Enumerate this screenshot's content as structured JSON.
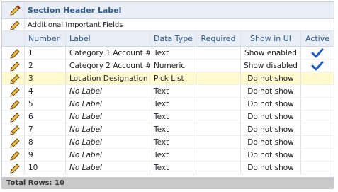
{
  "section_title": "Section Header Label",
  "subtitle": "Additional Important Fields",
  "columns": {
    "number": "Number",
    "label": "Label",
    "data_type": "Data Type",
    "required": "Required",
    "show_in_ui": "Show in UI",
    "active": "Active"
  },
  "rows": [
    {
      "number": "1",
      "label": "Category 1 Account #",
      "data_type": "Text",
      "required": "",
      "show_in_ui": "Show enabled",
      "active": true
    },
    {
      "number": "2",
      "label": "Category 2 Account #",
      "data_type": "Numeric",
      "required": "",
      "show_in_ui": "Show disabled",
      "active": true
    },
    {
      "number": "3",
      "label": "Location Designation",
      "data_type": "Pick List",
      "required": "",
      "show_in_ui": "Do not show",
      "active": false,
      "highlighted": true
    },
    {
      "number": "4",
      "label": "No Label",
      "data_type": "Text",
      "required": "",
      "show_in_ui": "Do not show",
      "active": false,
      "placeholder": true
    },
    {
      "number": "5",
      "label": "No Label",
      "data_type": "Text",
      "required": "",
      "show_in_ui": "Do not show",
      "active": false,
      "placeholder": true
    },
    {
      "number": "6",
      "label": "No Label",
      "data_type": "Text",
      "required": "",
      "show_in_ui": "Do not show",
      "active": false,
      "placeholder": true
    },
    {
      "number": "7",
      "label": "No Label",
      "data_type": "Text",
      "required": "",
      "show_in_ui": "Do not show",
      "active": false,
      "placeholder": true
    },
    {
      "number": "8",
      "label": "No Label",
      "data_type": "Text",
      "required": "",
      "show_in_ui": "Do not show",
      "active": false,
      "placeholder": true
    },
    {
      "number": "9",
      "label": "No Label",
      "data_type": "Text",
      "required": "",
      "show_in_ui": "Do not show",
      "active": false,
      "placeholder": true
    },
    {
      "number": "10",
      "label": "No Label",
      "data_type": "Text",
      "required": "",
      "show_in_ui": "Do not show",
      "active": false,
      "placeholder": true
    }
  ],
  "footer": "Total Rows: 10",
  "colors": {
    "header_text": "#2f5c8a",
    "highlight": "#fffacd",
    "check": "#1f57c3",
    "footer_bg": "#c9c9c9"
  },
  "icons": {
    "row_edit": "pencil-icon",
    "header_edit": "pencil-edit-icon",
    "active": "checkmark-icon"
  }
}
